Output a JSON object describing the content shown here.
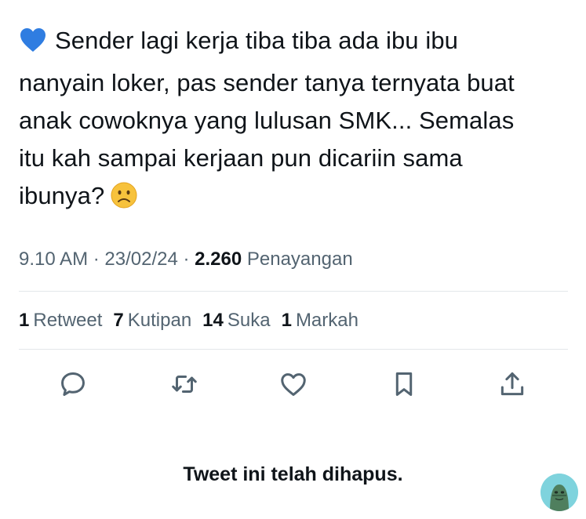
{
  "tweet": {
    "text_lines": [
      "Sender lagi kerja tiba tiba ada ibu ibu",
      "nanyain loker, pas sender tanya ternyata buat",
      "anak cowoknya yang lulusan SMK... Semalas",
      "itu kah sampai kerjaan pun dicariin sama",
      "ibunya?"
    ],
    "leading_emoji": "blue-heart-icon",
    "trailing_emoji": "frowning-face-icon"
  },
  "meta": {
    "time": "9.10 AM",
    "sep1": " · ",
    "date": "23/02/24",
    "sep2": " · ",
    "views_count": "2.260",
    "views_label": "Penayangan"
  },
  "stats": [
    {
      "count": "1",
      "label": "Retweet"
    },
    {
      "count": "7",
      "label": "Kutipan"
    },
    {
      "count": "14",
      "label": "Suka"
    },
    {
      "count": "1",
      "label": "Markah"
    }
  ],
  "actions": [
    {
      "name": "reply",
      "icon": "reply-icon"
    },
    {
      "name": "retweet",
      "icon": "retweet-icon"
    },
    {
      "name": "like",
      "icon": "heart-icon"
    },
    {
      "name": "bookmark",
      "icon": "bookmark-icon"
    },
    {
      "name": "share",
      "icon": "share-icon"
    }
  ],
  "deleted_notice": "Tweet ini telah dihapus.",
  "colors": {
    "text": "#0f1419",
    "secondary": "#536471",
    "icon": "#536471",
    "divider": "#e3e7ea",
    "heart_blue": "#2f7de1",
    "sad_face": "#f7c23c",
    "avatar_bg": "#7fd3dd"
  }
}
